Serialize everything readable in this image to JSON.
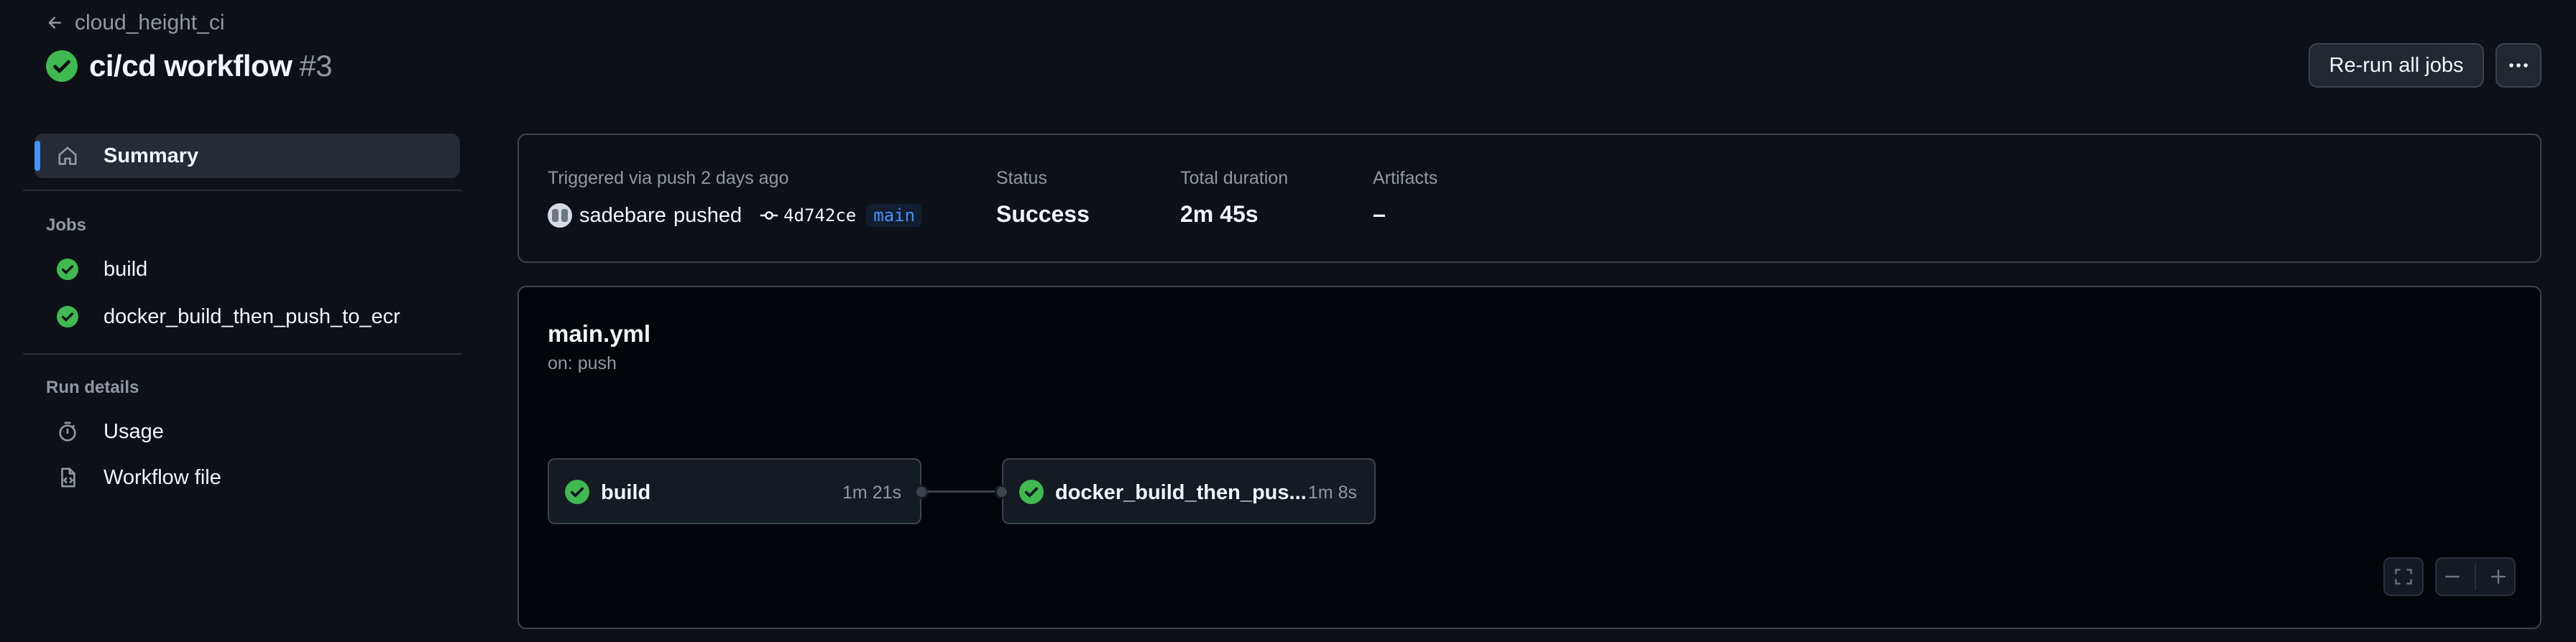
{
  "header": {
    "back_label": "cloud_height_ci",
    "title": "ci/cd workflow",
    "run_number": "#3",
    "rerun_label": "Re-run all jobs",
    "more_icon": "kebab-horizontal-icon"
  },
  "sidebar": {
    "summary_label": "Summary",
    "jobs_title": "Jobs",
    "jobs": [
      {
        "label": "build",
        "status": "success"
      },
      {
        "label": "docker_build_then_push_to_ecr",
        "status": "success"
      }
    ],
    "run_details_title": "Run details",
    "usage_label": "Usage",
    "workflow_file_label": "Workflow file"
  },
  "summary": {
    "trigger_text": "Triggered via push 2 days ago",
    "user": "sadebare",
    "action": "pushed",
    "commit": "4d742ce",
    "branch": "main",
    "status_label": "Status",
    "status_value": "Success",
    "duration_label": "Total duration",
    "duration_value": "2m 45s",
    "artifacts_label": "Artifacts",
    "artifacts_value": "–"
  },
  "graph": {
    "file_name": "main.yml",
    "trigger": "on: push",
    "jobs": [
      {
        "name": "build",
        "duration": "1m 21s",
        "status": "success"
      },
      {
        "name": "docker_build_then_pus...",
        "duration": "1m 8s",
        "status": "success"
      }
    ]
  },
  "colors": {
    "success": "#3fb950",
    "accent": "#4493f8",
    "background": "#0d1117",
    "border": "#3d444d"
  }
}
